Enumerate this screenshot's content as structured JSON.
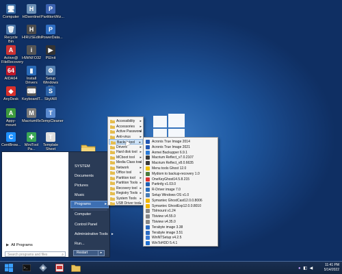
{
  "desktop": {
    "icons": [
      {
        "label": "Computer",
        "glyph": "🖥",
        "color": "#3b6ea5"
      },
      {
        "label": "HDsentinel",
        "glyph": "H",
        "color": "#6a8fb5"
      },
      {
        "label": "PartitionWiz...",
        "glyph": "P",
        "color": "#3b62b0"
      },
      {
        "label": "Recycle Bin",
        "glyph": "🗑",
        "color": "#4c77a8"
      },
      {
        "label": "HIRUSEditor",
        "glyph": "H",
        "color": "#4b4b4b"
      },
      {
        "label": "PowerData...",
        "glyph": "P",
        "color": "#2f6ec2"
      },
      {
        "label": "Active@ FileRecovery",
        "glyph": "A",
        "color": "#c33"
      },
      {
        "label": "HWiNFO32",
        "glyph": "i",
        "color": "#555"
      },
      {
        "label": "PEInit",
        "glyph": "▶",
        "color": "#333"
      },
      {
        "label": "AIDA64",
        "glyph": "64",
        "color": "#c0182a"
      },
      {
        "label": "Install Drivers",
        "glyph": "▮",
        "color": "#2a6bb8"
      },
      {
        "label": "Setup Windows OS",
        "glyph": "⚙",
        "color": "#5580b0"
      },
      {
        "label": "AnyDesk",
        "glyph": "◆",
        "color": "#d9302b"
      },
      {
        "label": "KeyboardT...",
        "glyph": "⌨",
        "color": "#555"
      },
      {
        "label": "SkyIAR",
        "glyph": "S",
        "color": "#2b63a9"
      },
      {
        "label": "Appy-mount",
        "glyph": "A",
        "color": "#3d9a3d"
      },
      {
        "label": "MacriumRe...",
        "glyph": "M",
        "color": "#7a7a7a"
      },
      {
        "label": "TempCleaner",
        "glyph": "T",
        "color": "#5a8ad0"
      },
      {
        "label": "CentBrow...",
        "glyph": "C",
        "color": "#1e90ff"
      },
      {
        "label": "MiniTool Pa...",
        "glyph": "✚",
        "color": "#3aa655"
      },
      {
        "label": "Template Sheet",
        "glyph": "T",
        "color": "#ddd"
      }
    ]
  },
  "start_menu": {
    "all_programs": "All Programs",
    "search_placeholder": "Search programs and files",
    "right_items": {
      "system": "SYSTEM",
      "documents": "Documents",
      "pictures": "Pictures",
      "music": "Music",
      "programs": "Programs",
      "computer": "Computer",
      "control_panel": "Control Panel",
      "admin_tools": "Administrative Tools",
      "run": "Run..."
    },
    "restart": "Restart"
  },
  "programs_menu": [
    {
      "label": "Accessibility"
    },
    {
      "label": "Accessories"
    },
    {
      "label": "Active Password"
    },
    {
      "label": "Anti-virus"
    },
    {
      "label": "Backup tool"
    },
    {
      "label": "Drivers"
    },
    {
      "label": "Hard disk tool"
    },
    {
      "label": "MCboot tool"
    },
    {
      "label": "Media Class tool"
    },
    {
      "label": "Network"
    },
    {
      "label": "Office tool"
    },
    {
      "label": "Partition tool"
    },
    {
      "label": "Partition Tools"
    },
    {
      "label": "Recovery tool"
    },
    {
      "label": "Registry Tools"
    },
    {
      "label": "System Tools"
    },
    {
      "label": "USB Driver tool"
    }
  ],
  "backup_menu": [
    {
      "label": "Acronis True Image 2014",
      "color": "#2457b3"
    },
    {
      "label": "Acronis True Image 2021",
      "color": "#2457b3"
    },
    {
      "label": "Aomei Backupper 6.9.1",
      "color": "#2b7bd6"
    },
    {
      "label": "Macrium Reflect_v7.0.2107",
      "color": "#3a3a3a"
    },
    {
      "label": "Macrium Reflect_v8.0.6635",
      "color": "#3a3a3a"
    },
    {
      "label": "Menu tools Ghost 12.0",
      "color": "#f0c000"
    },
    {
      "label": "Mydiom to backup-recovery 1.0",
      "color": "#4b7a3c"
    },
    {
      "label": "OneKeyGhost14.5.8.215",
      "color": "#d33"
    },
    {
      "label": "Partinfg v1.03.0",
      "color": "#2060b0"
    },
    {
      "label": "R-Driver image 7.0",
      "color": "#2c6fbd"
    },
    {
      "label": "Setup Windows OS v1.0",
      "color": "#4a7db5"
    },
    {
      "label": "Symantec GhostCast12.0.0.8006",
      "color": "#f2b705"
    },
    {
      "label": "Symantec GhostExp12.0.0.8010",
      "color": "#f2b705"
    },
    {
      "label": "TbImount v1.24",
      "color": "#888"
    },
    {
      "label": "Tbiview v4.55.0",
      "color": "#888"
    },
    {
      "label": "Tbiview v4.35.0",
      "color": "#888"
    },
    {
      "label": "Terabyte image 3.38",
      "color": "#2b6cc4"
    },
    {
      "label": "Terabyte image 3.51",
      "color": "#2b6cc4"
    },
    {
      "label": "WinNTSetup v4.2.5",
      "color": "#3a7bd5"
    },
    {
      "label": "WinToHDD 5.4.1",
      "color": "#1f6fd0"
    }
  ],
  "taskbar": {
    "time": "11:41 PM",
    "date": "5/14/2022"
  },
  "colors": {
    "accent": "#3d6fb3",
    "desktop_bg": "#1f5aa3",
    "taskbar_bg": "#122540"
  }
}
